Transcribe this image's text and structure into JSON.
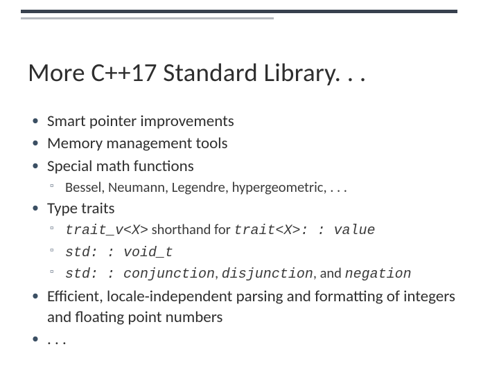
{
  "title": "More C++17 Standard Library. . .",
  "bullets": {
    "b0": "Smart pointer improvements",
    "b1": "Memory management tools",
    "b2": "Special math functions",
    "b2_sub": {
      "s0": "Bessel, Neumann, Legendre, hypergeometric, . . ."
    },
    "b3": "Type traits",
    "b3_sub": {
      "s0_code1": "trait_v<X>",
      "s0_mid": " shorthand for ",
      "s0_code2": "trait<X>: : value",
      "s1_code": "std: : void_t",
      "s2_code1": "std: : conjunction",
      "s2_sep1": ", ",
      "s2_code2": "disjunction",
      "s2_sep2": ", and ",
      "s2_code3": "negation"
    },
    "b4": "Efficient, locale-independent parsing and formatting of integers and floating point numbers",
    "b5": ". . ."
  }
}
